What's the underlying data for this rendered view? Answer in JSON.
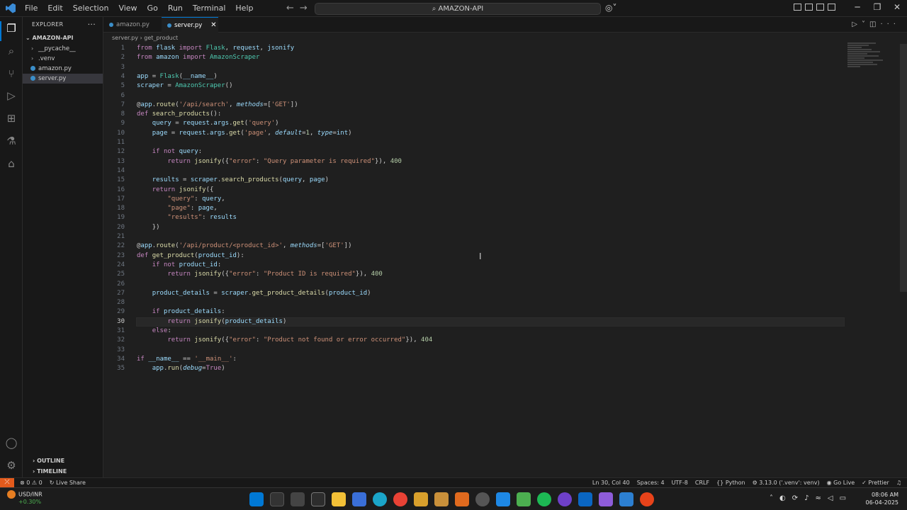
{
  "window": {
    "menu": [
      "File",
      "Edit",
      "Selection",
      "View",
      "Go",
      "Run",
      "Terminal",
      "Help"
    ],
    "search": "AMAZON-API"
  },
  "sidebar": {
    "title": "EXPLORER",
    "folder": "AMAZON-API",
    "items": [
      {
        "label": "__pycache__",
        "type": "folder"
      },
      {
        "label": ".venv",
        "type": "folder"
      },
      {
        "label": "amazon.py",
        "type": "file"
      },
      {
        "label": "server.py",
        "type": "file",
        "selected": true
      }
    ],
    "outline": "OUTLINE",
    "timeline": "TIMELINE"
  },
  "tabs": [
    {
      "label": "amazon.py",
      "active": false
    },
    {
      "label": "server.py",
      "active": true
    }
  ],
  "breadcrumb": {
    "file": "server.py",
    "symbol": "get_product"
  },
  "editor": {
    "current_line": 30,
    "lines": [
      "from flask import Flask, request, jsonify",
      "from amazon import AmazonScraper",
      "",
      "app = Flask(__name__)",
      "scraper = AmazonScraper()",
      "",
      "@app.route('/api/search', methods=['GET'])",
      "def search_products():",
      "    query = request.args.get('query')",
      "    page = request.args.get('page', default=1, type=int)",
      "",
      "    if not query:",
      "        return jsonify({\"error\": \"Query parameter is required\"}), 400",
      "",
      "    results = scraper.search_products(query, page)",
      "    return jsonify({",
      "        \"query\": query,",
      "        \"page\": page,",
      "        \"results\": results",
      "    })",
      "",
      "@app.route('/api/product/<product_id>', methods=['GET'])",
      "def get_product(product_id):",
      "    if not product_id:",
      "        return jsonify({\"error\": \"Product ID is required\"}), 400",
      "",
      "    product_details = scraper.get_product_details(product_id)",
      "",
      "    if product_details:",
      "        return jsonify(product_details)",
      "    else:",
      "        return jsonify({\"error\": \"Product not found or error occurred\"}), 404",
      "",
      "if __name__ == '__main__':",
      "    app.run(debug=True)"
    ]
  },
  "statusbar": {
    "problems": "⊗ 0 ⚠ 0",
    "live_share": "Live Share",
    "position": "Ln 30, Col 40",
    "spaces": "Spaces: 4",
    "encoding": "UTF-8",
    "eol": "CRLF",
    "language": "Python",
    "interpreter": "3.13.0 ('.venv': venv)",
    "go_live": "Go Live",
    "prettier": "Prettier"
  },
  "taskbar": {
    "ticker_name": "USD/INR",
    "ticker_change": "+0.30%",
    "time": "08:06 AM",
    "date": "06-04-2025"
  },
  "colors": {
    "keyword": "#c586c0",
    "function": "#dcdcaa",
    "string": "#ce9178",
    "number": "#b5cea8",
    "class": "#4ec9b0",
    "accent": "#0078d4"
  }
}
